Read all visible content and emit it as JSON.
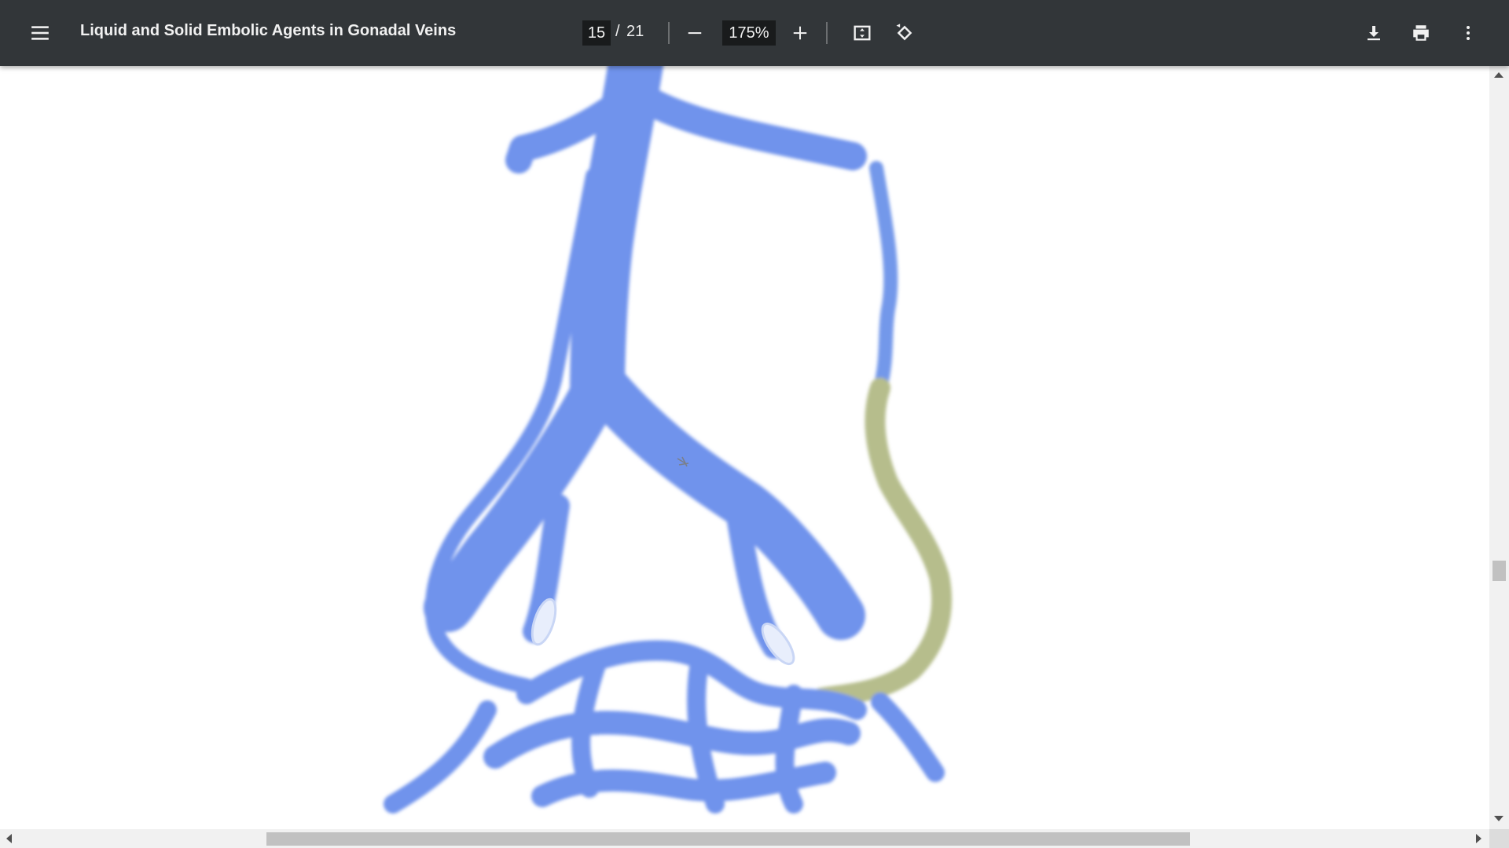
{
  "toolbar": {
    "title": "Liquid and Solid Embolic Agents in Gonadal Veins",
    "current_page": "15",
    "page_separator": "/",
    "total_pages": "21",
    "zoom_level": "175%",
    "icons": {
      "menu": "menu-icon",
      "zoom_out": "minus-icon",
      "zoom_in": "plus-icon",
      "fit": "fit-page-icon",
      "rotate": "rotate-icon",
      "download": "download-icon",
      "print": "print-icon",
      "more": "more-vert-icon"
    }
  },
  "document": {
    "illustration": "vein-diagram"
  },
  "colors": {
    "toolbar_bg": "#323639",
    "vein_blue": "#6f93ec",
    "embolic_yellow": "#b6bd8c",
    "coil_white": "#e8eefc"
  }
}
